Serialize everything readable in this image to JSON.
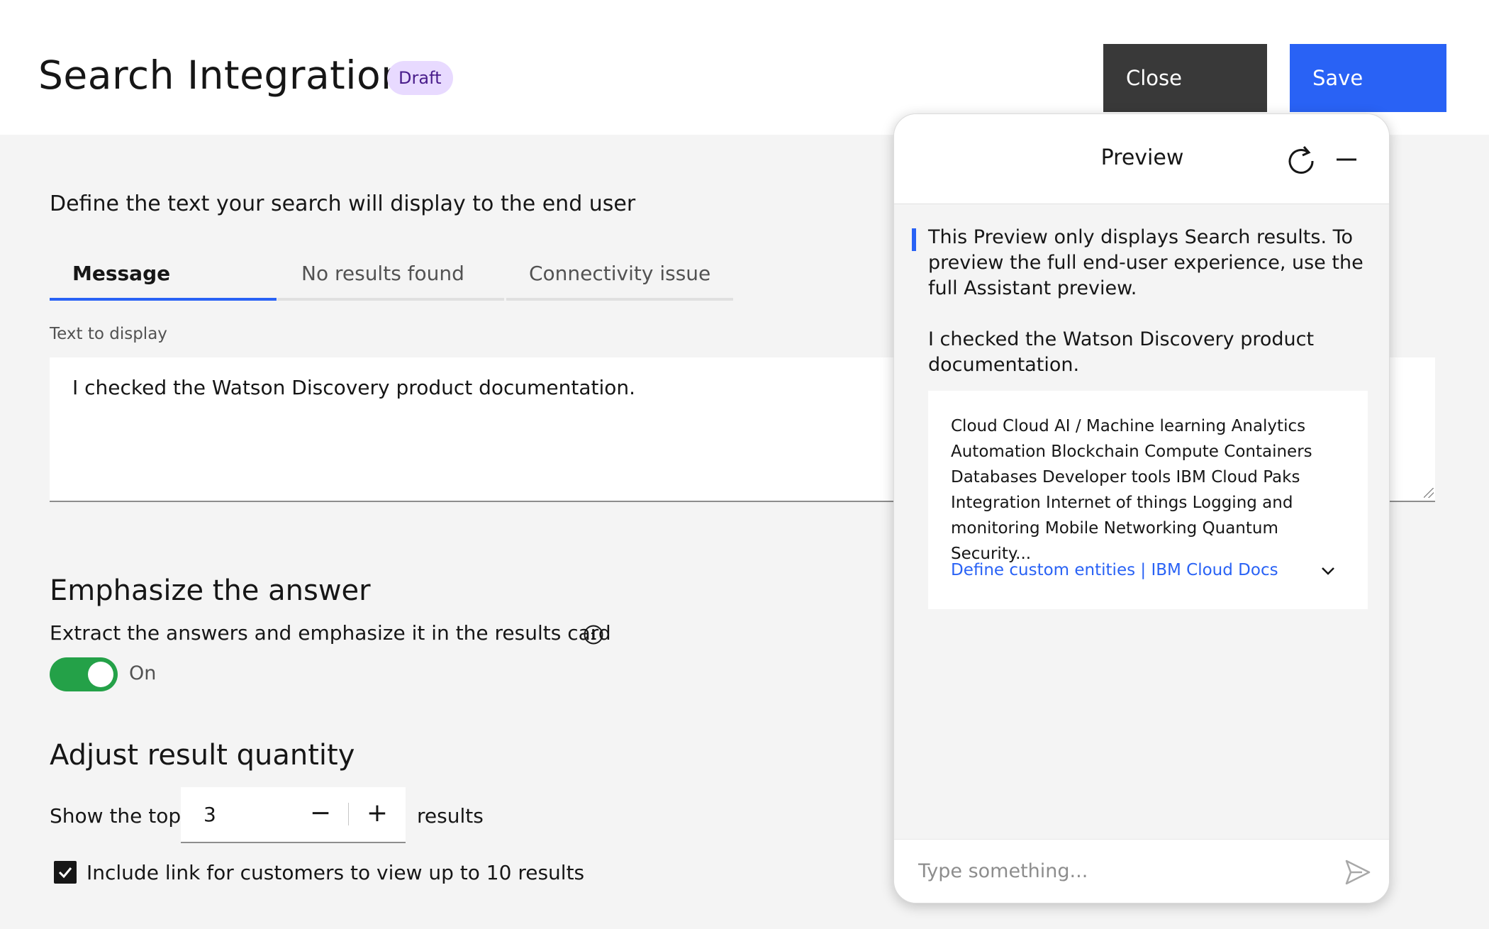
{
  "header": {
    "title": "Search Integration",
    "status_tag": "Draft",
    "close_label": "Close",
    "save_label": "Save"
  },
  "main": {
    "intro": "Define the text your search will display to the end user",
    "tabs": [
      {
        "label": "Message",
        "active": true
      },
      {
        "label": "No results found",
        "active": false
      },
      {
        "label": "Connectivity issue",
        "active": false
      }
    ],
    "text_field_label": "Text to display",
    "text_field_value": "I checked the Watson Discovery product documentation.",
    "emphasize": {
      "heading": "Emphasize the answer",
      "description": "Extract the answers and emphasize it in the results card",
      "info_icon": "info-icon",
      "toggle_state_label": "On",
      "toggle_on": true
    },
    "adjust": {
      "heading": "Adjust result quantity",
      "prefix": "Show the top",
      "value": "3",
      "minus": "−",
      "plus": "+",
      "suffix": "results",
      "checkbox_label": "Include link for customers to view up to 10 results",
      "checkbox_checked": true
    }
  },
  "preview": {
    "title": "Preview",
    "refresh_icon": "refresh-icon",
    "minimize_icon": "minimize-icon",
    "notice": "This Preview only displays Search results. To preview the full end-user experience, use the full Assistant preview.",
    "response": "I checked the Watson Discovery product documentation.",
    "result_card": {
      "body": "Cloud Cloud AI / Machine learning Analytics Automation Blockchain Compute Containers Databases Developer tools IBM Cloud Paks Integration Internet of things Logging and monitoring Mobile Networking Quantum Security...",
      "link": "Define custom entities | IBM Cloud Docs",
      "expand_icon": "chevron-down-icon"
    },
    "input_placeholder": "Type something...",
    "send_icon": "send-icon"
  },
  "colors": {
    "accent": "#2962f5",
    "toggle_on": "#24a148",
    "close_button": "#393939",
    "draft_tag_bg": "#e8daff",
    "draft_tag_text": "#491d8b"
  }
}
